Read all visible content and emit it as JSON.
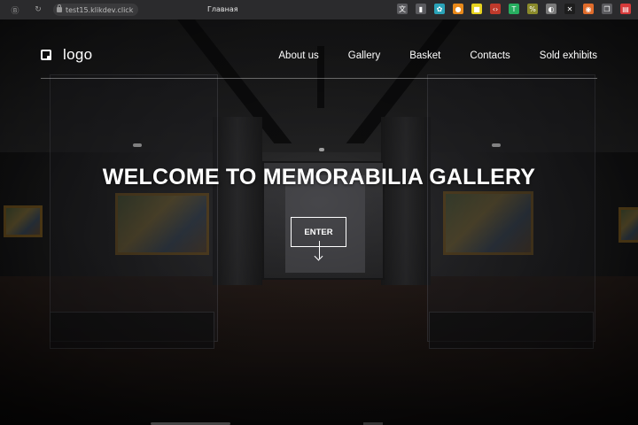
{
  "browser": {
    "url": "test15.klikdev.click",
    "tab_title": "Главная",
    "extensions": [
      {
        "name": "translate-icon",
        "color": "#5b5b5f",
        "glyph": "文"
      },
      {
        "name": "bookmark-icon",
        "color": "#5b5b5f",
        "glyph": "▮"
      },
      {
        "name": "globe-icon",
        "color": "#2aa3b8",
        "glyph": "✿"
      },
      {
        "name": "ext-orange-icon",
        "color": "#e8891b",
        "glyph": "●"
      },
      {
        "name": "ext-yellow-icon",
        "color": "#e6d21f",
        "glyph": "■"
      },
      {
        "name": "code-icon",
        "color": "#c0392b",
        "glyph": "‹›"
      },
      {
        "name": "ext-green-icon",
        "color": "#27ae60",
        "glyph": "T"
      },
      {
        "name": "ext-olive-icon",
        "color": "#8a8a2a",
        "glyph": "%"
      },
      {
        "name": "ext-grey-icon",
        "color": "#7a7a7a",
        "glyph": "◐"
      },
      {
        "name": "close-x-icon",
        "color": "#1d1d1d",
        "glyph": "✕"
      },
      {
        "name": "ext-firefox-icon",
        "color": "#e06c2b",
        "glyph": "◉"
      },
      {
        "name": "copy-icon",
        "color": "#5b5b5f",
        "glyph": "❐"
      },
      {
        "name": "ext-red-icon",
        "color": "#d63a3a",
        "glyph": "▤"
      }
    ]
  },
  "header": {
    "logo_text": "logo",
    "menu": [
      "About us",
      "Gallery",
      "Basket",
      "Contacts",
      "Sold exhibits"
    ]
  },
  "hero": {
    "title": "WELCOME TO MEMORABILIA GALLERY",
    "enter_label": "ENTER"
  }
}
